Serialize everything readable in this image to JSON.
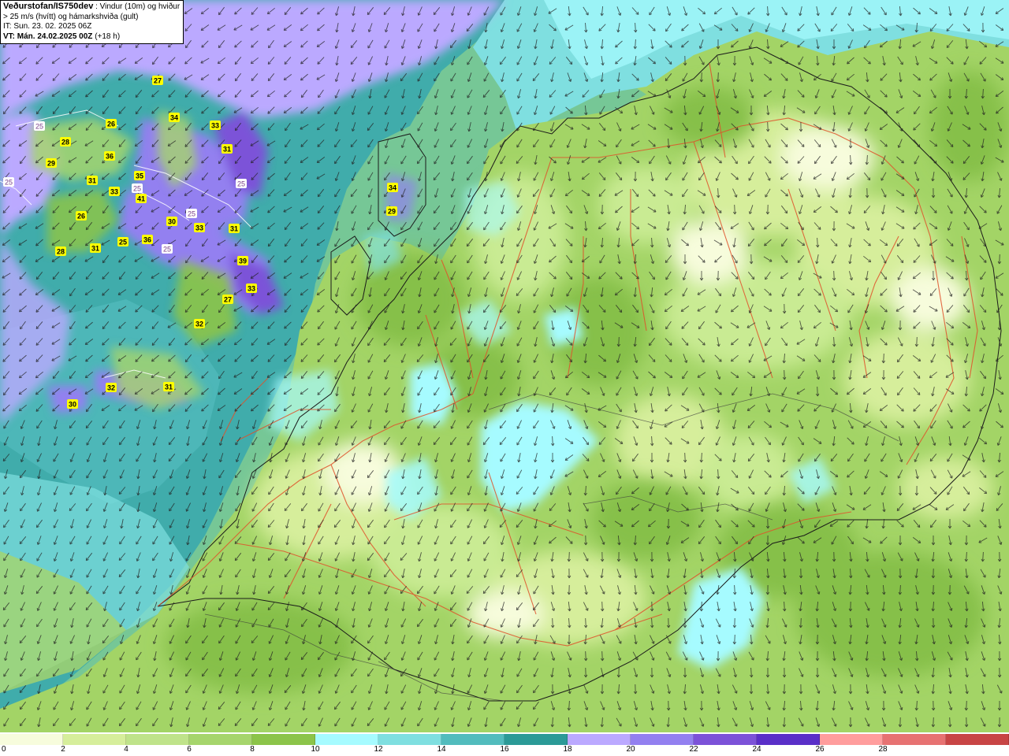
{
  "header": {
    "title": "Veðurstofan/IS750dev",
    "description": " : Vindur (10m) og hviður > 25 m/s (hvítt) og hámarkshviða (gult)",
    "issue_time": "IT: Sun. 23. 02. 2025 06Z",
    "valid_time_label": "VT: Mán. 24.02.2025 00Z",
    "lead_time": "(+18 h)"
  },
  "legend": {
    "colors": [
      "#f7fcdc",
      "#d6ee9b",
      "#bfe38a",
      "#a6d56c",
      "#8cc449",
      "#a6fbff",
      "#7fdfe0",
      "#52bcbd",
      "#2b9a97",
      "#bba9ff",
      "#9380f0",
      "#7c52d8",
      "#5a2fc8",
      "#ff9d9d",
      "#e77272",
      "#c84545"
    ],
    "ticks": [
      "0",
      "2",
      "4",
      "6",
      "8",
      "10",
      "12",
      "14",
      "16",
      "18",
      "20",
      "22",
      "24",
      "26",
      "28"
    ]
  },
  "gust_labels": {
    "yellow": [
      "27",
      "34",
      "33",
      "26",
      "31",
      "28",
      "36",
      "29",
      "31",
      "33",
      "35",
      "41",
      "26",
      "30",
      "33",
      "31",
      "28",
      "31",
      "25",
      "36",
      "39",
      "33",
      "27",
      "32",
      "32",
      "31",
      "30",
      "34",
      "29"
    ],
    "white": [
      "25",
      "25",
      "25",
      "25",
      "25",
      "25"
    ]
  },
  "colors": {
    "ocean_calm": "#4fb9b4",
    "ocean_strong": "#2a9a96",
    "storm": "#9a7de8",
    "land_light": "#c9eb93",
    "land_mid": "#a6d56c",
    "land_dark": "#86c048",
    "road": "#e0522b",
    "coast": "#1a1a1a",
    "gust_yellow": "#ffff00"
  }
}
